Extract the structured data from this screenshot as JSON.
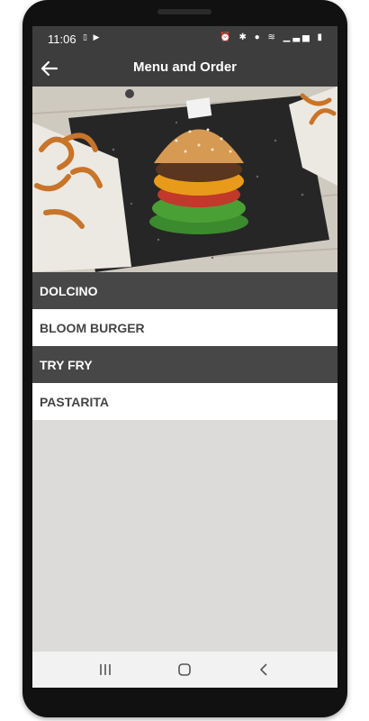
{
  "status_bar": {
    "time": "11:06",
    "left_icons": [
      "notification-icon",
      "youtube-icon"
    ],
    "right_icons": [
      "alarm-icon",
      "bluetooth-icon",
      "location-icon",
      "wifi-icon",
      "signal-icon",
      "battery-icon"
    ]
  },
  "app_bar": {
    "title": "Menu and Order",
    "back_icon": "arrow-left-icon"
  },
  "hero_image": {
    "subject": "burger-and-fries-photo"
  },
  "menu": {
    "items": [
      {
        "label": "DOLCINO",
        "style": "dark"
      },
      {
        "label": "BLOOM BURGER",
        "style": "light"
      },
      {
        "label": "TRY FRY",
        "style": "dark"
      },
      {
        "label": "PASTARITA",
        "style": "light"
      }
    ]
  },
  "nav_bar": {
    "buttons": [
      "recent-apps-icon",
      "home-icon",
      "back-icon"
    ]
  },
  "colors": {
    "app_bar": "#3d3d3d",
    "dark_item": "#474747",
    "light_item": "#ffffff",
    "background": "#dcdbd9"
  }
}
